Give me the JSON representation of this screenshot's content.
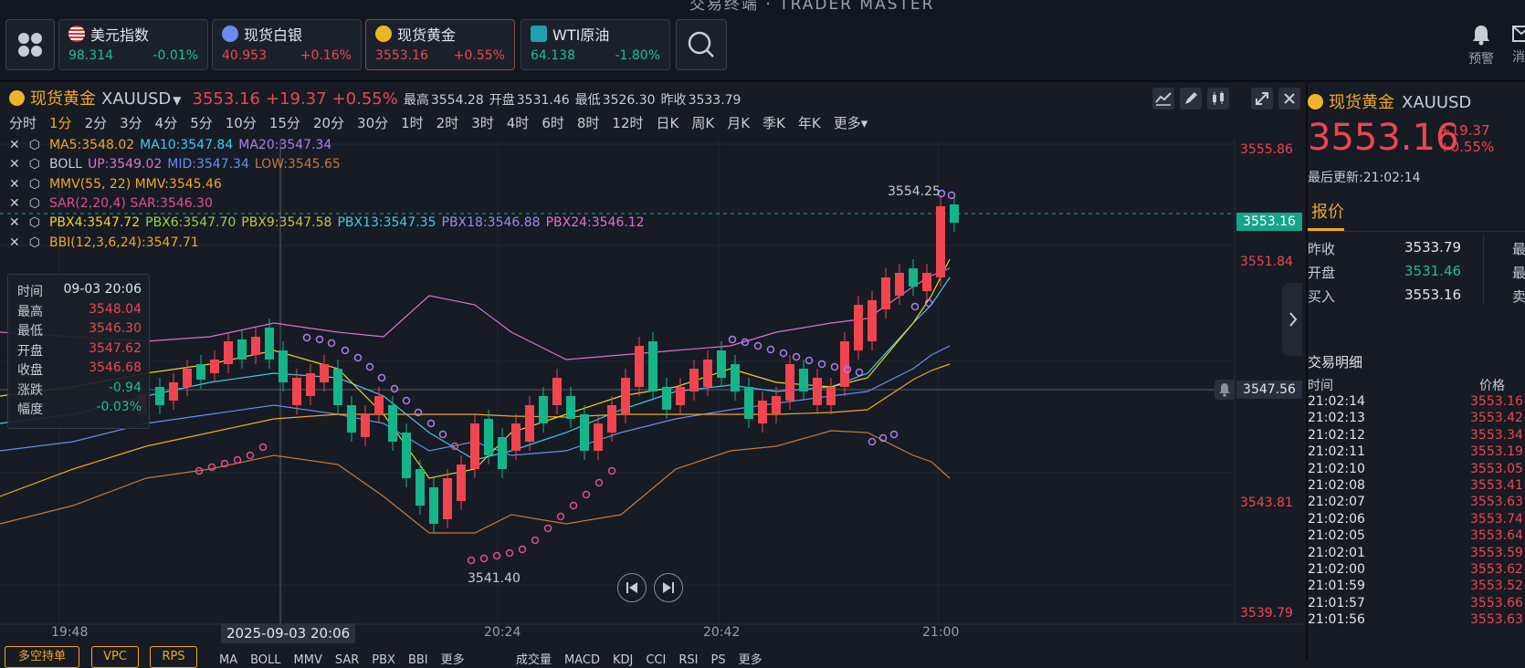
{
  "app_title": "交易终端 · TRADER MASTER",
  "tickers": [
    {
      "name": "美元指数",
      "price": "98.314",
      "change": "-0.01%",
      "dir": "green"
    },
    {
      "name": "现货白银",
      "price": "40.953",
      "change": "+0.16%",
      "dir": "red"
    },
    {
      "name": "现货黄金",
      "price": "3553.16",
      "change": "+0.55%",
      "dir": "red"
    },
    {
      "name": "WTI原油",
      "price": "64.138",
      "change": "-1.80%",
      "dir": "green"
    }
  ],
  "top_right": {
    "alarm_label": "预警",
    "msg_label": "消"
  },
  "symbol": {
    "name": "现货黄金",
    "code": "XAUUSD",
    "price": "3553.16",
    "change": "+19.37",
    "change_pct": "+0.55%",
    "high_label": "最高",
    "high": "3554.28",
    "open_label": "开盘",
    "open": "3531.46",
    "low_label": "最低",
    "low": "3526.30",
    "prev_label": "昨收",
    "prev": "3533.79"
  },
  "timeframes": [
    "分时",
    "1分",
    "2分",
    "3分",
    "4分",
    "5分",
    "10分",
    "15分",
    "20分",
    "30分",
    "1时",
    "2时",
    "3时",
    "4时",
    "6时",
    "8时",
    "12时",
    "日K",
    "周K",
    "月K",
    "季K",
    "年K",
    "更多"
  ],
  "selected_timeframe": "1分",
  "indicators": [
    [
      {
        "t": "MA5:3548.02",
        "c": "#f5a623"
      },
      {
        "t": "MA10:3547.84",
        "c": "#45c8f0"
      },
      {
        "t": "MA20:3547.34",
        "c": "#b07cf0"
      }
    ],
    [
      {
        "t": "BOLL",
        "c": "#c8ccd4"
      },
      {
        "t": "UP:3549.02",
        "c": "#e070d0"
      },
      {
        "t": "MID:3547.34",
        "c": "#6a8cf0"
      },
      {
        "t": "LOW:3545.65",
        "c": "#c8783a"
      }
    ],
    [
      {
        "t": "MMV(55, 22) MMV:3545.46",
        "c": "#f5a623"
      }
    ],
    [
      {
        "t": "SAR(2,20,4) SAR:3546.30",
        "c": "#e0508a"
      }
    ],
    [
      {
        "t": "PBX4:3547.72",
        "c": "#f5d020"
      },
      {
        "t": "PBX6:3547.70",
        "c": "#9ad04a"
      },
      {
        "t": "PBX9:3547.58",
        "c": "#d0c040"
      },
      {
        "t": "PBX13:3547.35",
        "c": "#45c8f0"
      },
      {
        "t": "PBX18:3546.88",
        "c": "#9a8cf0"
      },
      {
        "t": "PBX24:3546.12",
        "c": "#e070d0"
      }
    ],
    [
      {
        "t": "BBI(12,3,6,24):3547.71",
        "c": "#f5a623"
      }
    ]
  ],
  "tooltip": {
    "rows": [
      {
        "label": "时间",
        "value": "09-03 20:06",
        "dir": "w"
      },
      {
        "label": "最高",
        "value": "3548.04",
        "dir": "r"
      },
      {
        "label": "最低",
        "value": "3546.30",
        "dir": "r"
      },
      {
        "label": "开盘",
        "value": "3547.62",
        "dir": "r"
      },
      {
        "label": "收盘",
        "value": "3546.68",
        "dir": "r"
      },
      {
        "label": "涨跌",
        "value": "-0.94",
        "dir": "g"
      },
      {
        "label": "幅度",
        "value": "-0.03%",
        "dir": "g"
      }
    ]
  },
  "price_axis": [
    "3555.86",
    "3551.84",
    "3547.56",
    "3543.81",
    "3539.79"
  ],
  "current_price_tag": "3553.16",
  "crosshair_price_tag": "3547.56",
  "time_axis": [
    "19:48",
    "2025-09-03 20:06",
    "20:24",
    "20:42",
    "21:00"
  ],
  "annotations": {
    "high": "3554.25",
    "low": "3541.40"
  },
  "bottom": {
    "buttons": [
      "多空持单",
      "VPC",
      "RPS"
    ],
    "ind_tabs": [
      "MA",
      "BOLL",
      "MMV",
      "SAR",
      "PBX",
      "BBI",
      "更多"
    ],
    "sub_tabs": [
      "成交量",
      "MACD",
      "KDJ",
      "CCI",
      "RSI",
      "PS",
      "更多"
    ]
  },
  "right": {
    "name": "现货黄金",
    "code": "XAUUSD",
    "price": "3553.16",
    "change": "+19.37",
    "change_pct": "+0.55%",
    "updated": "最后更新:21:02:14",
    "tab_quote": "报价",
    "quote_rows": [
      {
        "label": "昨收",
        "value": "3533.79",
        "dir": "w",
        "extra": "最"
      },
      {
        "label": "开盘",
        "value": "3531.46",
        "dir": "g",
        "extra": "最"
      },
      {
        "label": "买入",
        "value": "3553.16",
        "dir": "w",
        "extra": "卖"
      }
    ],
    "trades_title": "交易明细",
    "col_time": "时间",
    "col_price": "价格",
    "trades": [
      {
        "time": "21:02:14",
        "price": "3553.16"
      },
      {
        "time": "21:02:13",
        "price": "3553.42"
      },
      {
        "time": "21:02:12",
        "price": "3553.34"
      },
      {
        "time": "21:02:11",
        "price": "3553.19"
      },
      {
        "time": "21:02:10",
        "price": "3553.05"
      },
      {
        "time": "21:02:08",
        "price": "3553.41"
      },
      {
        "time": "21:02:07",
        "price": "3553.63"
      },
      {
        "time": "21:02:06",
        "price": "3553.74"
      },
      {
        "time": "21:02:05",
        "price": "3553.64"
      },
      {
        "time": "21:02:01",
        "price": "3553.59"
      },
      {
        "time": "21:02:00",
        "price": "3553.62"
      },
      {
        "time": "21:01:59",
        "price": "3553.52"
      },
      {
        "time": "21:01:57",
        "price": "3553.66"
      },
      {
        "time": "21:01:56",
        "price": "3553.63"
      }
    ]
  }
}
